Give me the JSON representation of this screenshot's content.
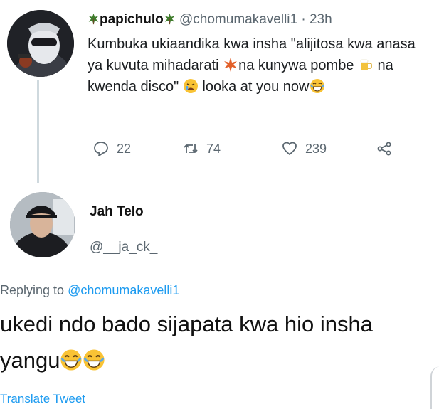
{
  "tweet1": {
    "name": "papichulo",
    "handle": "@chomumakavelli1",
    "separator": "·",
    "time": "23h",
    "text_parts": [
      "Kumbuka ukiaandika kwa insha \"alijitosa kwa anasa ya kuvuta mihadarati ",
      "na kunywa pombe ",
      " na kwenda disco\" ",
      " looka at you now"
    ],
    "emojis": [
      "leaf-emoji",
      "beer-emoji",
      "crying-face-emoji",
      "laughing-face-emoji"
    ],
    "actions": {
      "replies": "22",
      "retweets": "74",
      "likes": "239"
    }
  },
  "tweet2": {
    "name": "Jah Telo",
    "handle": "@__ja_ck_",
    "replying_prefix": "Replying to ",
    "replying_to": "@chomumakavelli1",
    "text": "ukedi ndo bado sijapata kwa hio insha yangu",
    "emojis": [
      "laughing-face-emoji",
      "laughing-face-emoji"
    ],
    "translate": "Translate Tweet"
  },
  "colors": {
    "link": "#1d9bf0",
    "secondary_text": "#5b6770",
    "thread_line": "#cfd9de"
  }
}
